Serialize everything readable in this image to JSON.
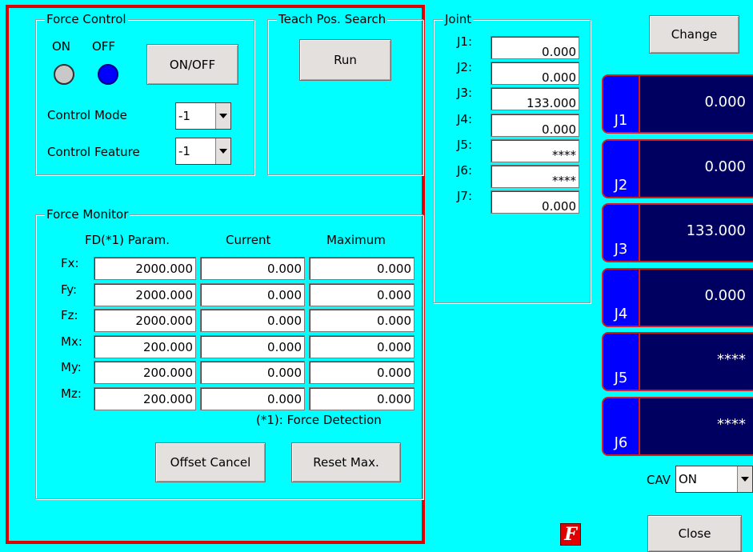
{
  "force_control": {
    "title": "Force Control",
    "on_label": "ON",
    "off_label": "OFF",
    "toggle_button": "ON/OFF",
    "control_mode_label": "Control Mode",
    "control_mode_value": "-1",
    "control_feature_label": "Control Feature",
    "control_feature_value": "-1"
  },
  "teach_pos_search": {
    "title": "Teach Pos. Search",
    "run_button": "Run"
  },
  "force_monitor": {
    "title": "Force Monitor",
    "col_param": "FD(*1) Param.",
    "col_current": "Current",
    "col_maximum": "Maximum",
    "rows": [
      {
        "label": "Fx:",
        "param": "2000.000",
        "current": "0.000",
        "maximum": "0.000"
      },
      {
        "label": "Fy:",
        "param": "2000.000",
        "current": "0.000",
        "maximum": "0.000"
      },
      {
        "label": "Fz:",
        "param": "2000.000",
        "current": "0.000",
        "maximum": "0.000"
      },
      {
        "label": "Mx:",
        "param": "200.000",
        "current": "0.000",
        "maximum": "0.000"
      },
      {
        "label": "My:",
        "param": "200.000",
        "current": "0.000",
        "maximum": "0.000"
      },
      {
        "label": "Mz:",
        "param": "200.000",
        "current": "0.000",
        "maximum": "0.000"
      }
    ],
    "footnote": "(*1): Force Detection",
    "offset_cancel_button": "Offset Cancel",
    "reset_max_button": "Reset Max."
  },
  "joint": {
    "title": "Joint",
    "rows": [
      {
        "label": "J1:",
        "value": "0.000"
      },
      {
        "label": "J2:",
        "value": "0.000"
      },
      {
        "label": "J3:",
        "value": "133.000"
      },
      {
        "label": "J4:",
        "value": "0.000"
      },
      {
        "label": "J5:",
        "value": "****"
      },
      {
        "label": "J6:",
        "value": "****"
      },
      {
        "label": "J7:",
        "value": "0.000"
      }
    ]
  },
  "right_panel": {
    "change_button": "Change",
    "joints": [
      {
        "tag": "J1",
        "value": "0.000"
      },
      {
        "tag": "J2",
        "value": "0.000"
      },
      {
        "tag": "J3",
        "value": "133.000"
      },
      {
        "tag": "J4",
        "value": "0.000"
      },
      {
        "tag": "J5",
        "value": "****"
      },
      {
        "tag": "J6",
        "value": "****"
      }
    ],
    "cav_label": "CAV",
    "cav_value": "ON",
    "close_button": "Close"
  },
  "status_icon": {
    "glyph": "F",
    "name": "force-status-icon"
  },
  "colors": {
    "background": "#00ffff",
    "highlight_frame": "#e00000",
    "led_on_off": "#c8c8c8",
    "led_active": "#0000ff",
    "joint_panel": "#000060",
    "joint_tag": "#0000ff"
  }
}
